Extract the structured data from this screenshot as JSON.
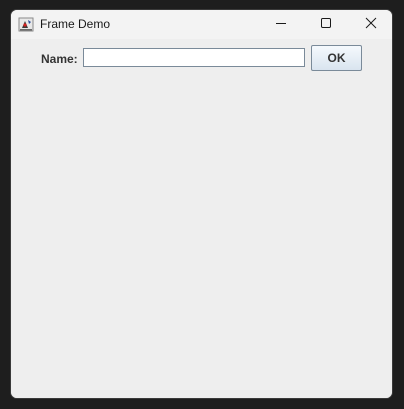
{
  "window": {
    "title": "Frame Demo",
    "app_icon": "java-duke-icon",
    "controls": {
      "minimize_icon": "minimize-icon",
      "maximize_icon": "maximize-icon",
      "close_icon": "close-icon"
    }
  },
  "form": {
    "name_label": "Name:",
    "name_value": "",
    "ok_label": "OK"
  },
  "colors": {
    "window_background": "#eeeeee",
    "titlebar_background": "#f3f3f3",
    "button_gradient_top": "#f5f9fd",
    "button_gradient_bottom": "#d9e4ef",
    "input_border": "#7a8a99"
  }
}
